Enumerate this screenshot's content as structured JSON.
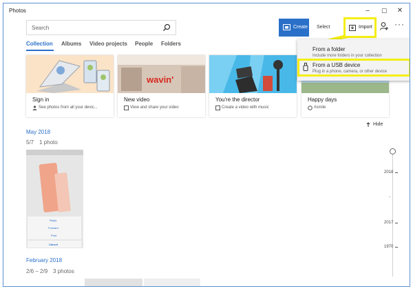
{
  "window": {
    "title": "Photos",
    "minimize": "–",
    "maximize": "☐",
    "close": "✕"
  },
  "search": {
    "placeholder": "Search"
  },
  "toolbar": {
    "create": "Create",
    "select": "Select",
    "import": "Import",
    "more": "···"
  },
  "tabs": [
    "Collection",
    "Albums",
    "Video projects",
    "People",
    "Folders"
  ],
  "cards": [
    {
      "title": "Sign in",
      "subtitle": "See photos from all your devic..."
    },
    {
      "title": "New video",
      "subtitle": "View and share your video"
    },
    {
      "title": "You're the director",
      "subtitle": "Create a video with music"
    },
    {
      "title": "Happy days",
      "subtitle": "#smile"
    }
  ],
  "card_art_text": "wavin'",
  "import_menu": {
    "items": [
      {
        "title": "From a folder",
        "subtitle": "Include more folders in your collection"
      },
      {
        "title": "From a USB device",
        "subtitle": "Plug in a phone, camera, or other device"
      }
    ]
  },
  "hide_label": "Hide",
  "sections": [
    {
      "title": "May 2018",
      "meta_dates": "5/7",
      "meta_count": "1 photo"
    },
    {
      "title": "February 2018",
      "meta_dates": "2/6 – 2/9",
      "meta_count": "3 photos"
    }
  ],
  "phone_screen": {
    "menu": [
      "Reply",
      "Forward",
      "Print"
    ],
    "cancel": "Cancel"
  },
  "timeline": {
    "years": [
      "2018",
      "-",
      "2017",
      "1970"
    ]
  },
  "colors": {
    "accent": "#2a70c8",
    "highlight": "#f4ee11"
  }
}
